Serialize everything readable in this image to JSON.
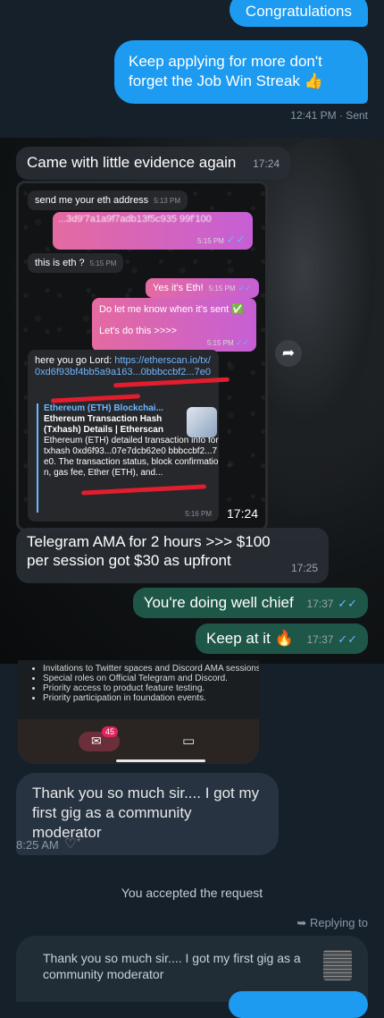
{
  "top_thread": {
    "msg1": "Congratulations",
    "msg2": "Keep applying for more don't forget the Job Win Streak 👍",
    "timestamp": "12:41 PM · Sent"
  },
  "telegram": {
    "caption": {
      "text": "Came with little evidence again",
      "time": "17:24"
    },
    "inner": {
      "m1": {
        "text": "send me your eth address",
        "time": "5:13 PM"
      },
      "m2": {
        "text": "...3d9'7a1a9f7adb13f5c935 99f'100",
        "time": "5:15 PM"
      },
      "m3": {
        "text": "this is eth ?",
        "time": "5:15 PM"
      },
      "m4": {
        "text": "Yes it's Eth!",
        "time": "5:15 PM"
      },
      "m5": {
        "text": "Do let me know when it's sent ✅",
        "text2": "Let's do this >>>>",
        "time": "5:15 PM"
      },
      "link_msg": {
        "prefix": "here you go Lord: ",
        "url": "https://etherscan.io/tx/0xd6f93bf4bb5a9a163...0bbbccbf2...7e0",
        "preview_site": "Ethereum (ETH) Blockchai...",
        "preview_title": "Ethereum Transaction Hash (Txhash) Details | Etherscan",
        "preview_desc": "Ethereum (ETH) detailed transaction info for txhash 0xd6f93...07e7dcb62e0 bbbccbf2...7e0. The transaction status, block confirmation, gas fee, Ether (ETH), and...",
        "time": "5:16 PM"
      }
    },
    "screenshot_time": "17:24",
    "msg_ama": {
      "text": "Telegram AMA for 2 hours >>> $100 per session got $30 as upfront",
      "time": "17:25"
    },
    "reply1": {
      "text": "You're doing well chief",
      "time": "17:37"
    },
    "reply2": {
      "text": "Keep at it 🔥",
      "time": "17:37"
    }
  },
  "lower_thread": {
    "card_items": [
      "Invitations to Twitter spaces and Discord AMA sessions.",
      "Special roles on Official Telegram and Discord.",
      "Priority access to product feature testing.",
      "Priority participation in foundation events."
    ],
    "mail_badge": "45",
    "received": "Thank you so much sir.... I got my first gig as a community moderator",
    "received_time": "8:25 AM",
    "system_note": "You accepted the request",
    "replying_label": "Replying to",
    "quote": "Thank you so much sir.... I got my first gig as a community moderator"
  },
  "colors": {
    "background": "#15202b",
    "sent_bubble": "#1d9bf0",
    "received_bubble": "#273340",
    "telegram_outgoing": "#1e5747",
    "read_tick": "#6fb1ff"
  },
  "icons": [
    "thumbs-up-icon",
    "share-arrow-icon",
    "double-check-icon",
    "fire-icon",
    "mail-icon",
    "video-icon",
    "heart-plus-icon",
    "reply-arrow-icon"
  ]
}
